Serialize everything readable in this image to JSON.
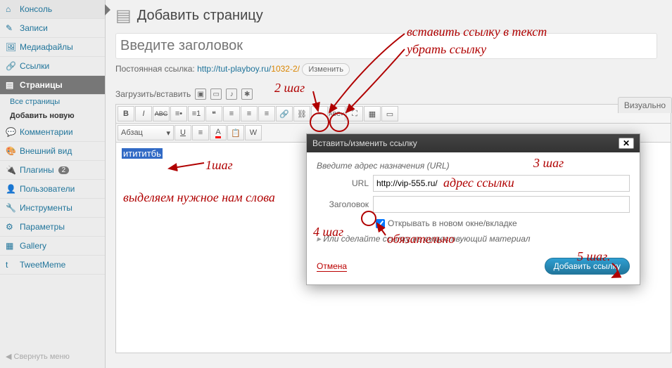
{
  "sidebar": {
    "items": [
      {
        "label": "Консоль"
      },
      {
        "label": "Записи"
      },
      {
        "label": "Медиафайлы"
      },
      {
        "label": "Ссылки"
      },
      {
        "label": "Страницы"
      },
      {
        "label": "Комментарии"
      },
      {
        "label": "Внешний вид"
      },
      {
        "label": "Плагины",
        "badge": "2"
      },
      {
        "label": "Пользователи"
      },
      {
        "label": "Инструменты"
      },
      {
        "label": "Параметры"
      },
      {
        "label": "Gallery"
      },
      {
        "label": "TweetMeme"
      }
    ],
    "sub": [
      {
        "label": "Все страницы"
      },
      {
        "label": "Добавить новую"
      }
    ],
    "collapse": "Свернуть меню"
  },
  "page": {
    "title": "Добавить страницу",
    "titlePlaceholder": "Введите заголовок",
    "permalink_label": "Постоянная ссылка:",
    "permalink_base": "http://tut-playboy.ru/",
    "permalink_slug": "1032-2/",
    "edit_btn": "Изменить",
    "upload_label": "Загрузить/вставить",
    "tab_visual": "Визуально"
  },
  "toolbar": {
    "format_select": "Абзац",
    "b": "B",
    "i": "I",
    "abc": "ABC",
    "u": "U",
    "a": "A"
  },
  "editor": {
    "selected": "итититбь"
  },
  "dialog": {
    "title": "Вставить/изменить ссылку",
    "intro": "Введите адрес назначения (URL)",
    "url_label": "URL",
    "url_value": "http://vip-555.ru/",
    "title_label": "Заголовок",
    "title_value": "",
    "checkbox_label": "Открывать в новом окне/вкладке",
    "existing": "Или сделайте ссылку на существующий материал",
    "cancel": "Отмена",
    "submit": "Добавить ссылку"
  },
  "annotations": {
    "step1": "1шаг",
    "step2": "2 шаг",
    "step3": "3 шаг",
    "step4": "4 шаг",
    "step5": "5 шаг.",
    "select_words": "выделяем нужное нам слова",
    "insert_link": "вставить ссылку в текст",
    "remove_link": "убрать ссылку",
    "address": "адрес ссылки",
    "mandatory": "обязательно"
  }
}
